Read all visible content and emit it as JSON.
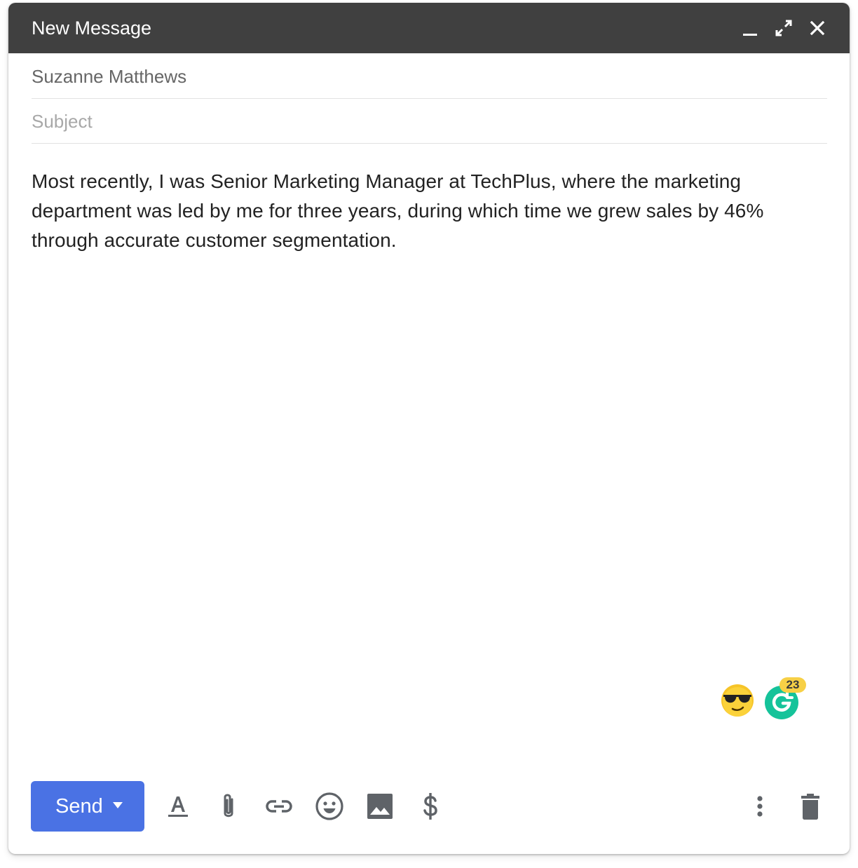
{
  "window": {
    "title": "New Message",
    "controls": [
      "minimize-icon",
      "expand-icon",
      "close-icon"
    ]
  },
  "to_field": {
    "value": "Suzanne Matthews"
  },
  "subject_field": {
    "value": "",
    "placeholder": "Subject"
  },
  "body": {
    "text": "Most recently, I was Senior Marketing Manager at TechPlus, where the marketing department was led by me for three years, during which time we grew sales by 46% through accurate customer segmentation."
  },
  "extensions": {
    "emoji_icon": "sunglasses-emoji-icon",
    "grammarly": {
      "icon": "grammarly-icon",
      "badge_count": "23"
    }
  },
  "toolbar": {
    "send_label": "Send",
    "tools": [
      "formatting-icon",
      "attach-icon",
      "link-icon",
      "emoji-icon",
      "photo-icon",
      "dollar-icon"
    ],
    "right": [
      "more-options-icon",
      "trash-icon"
    ]
  },
  "colors": {
    "titlebar": "#404040",
    "send_button": "#4a72e4",
    "grammarly": "#15c39a",
    "badge": "#f7d046",
    "icon": "#5f6368"
  }
}
